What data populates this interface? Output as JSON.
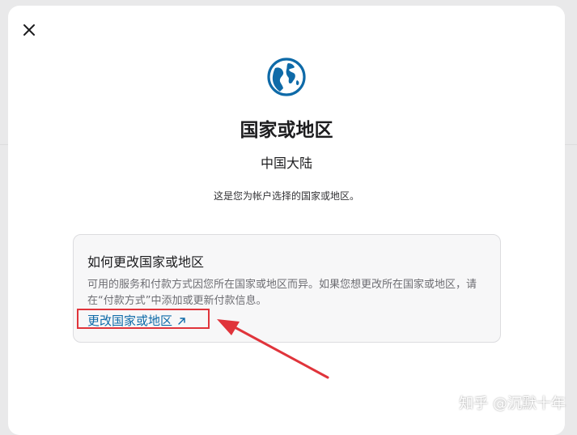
{
  "dialog": {
    "close_icon": "close-icon",
    "globe_icon": "globe-icon",
    "title": "国家或地区",
    "region": "中国大陆",
    "description": "这是您为帐户选择的国家或地区。"
  },
  "info_card": {
    "title": "如何更改国家或地区",
    "body": "可用的服务和付款方式因您所在国家或地区而异。如果您想更改所在国家或地区，请在“付款方式”中添加或更新付款信息。",
    "link_label": "更改国家或地区",
    "link_icon": "external-arrow-icon"
  },
  "annotation": {
    "color": "#e0343b"
  },
  "watermark": "知乎 @沉默十年"
}
